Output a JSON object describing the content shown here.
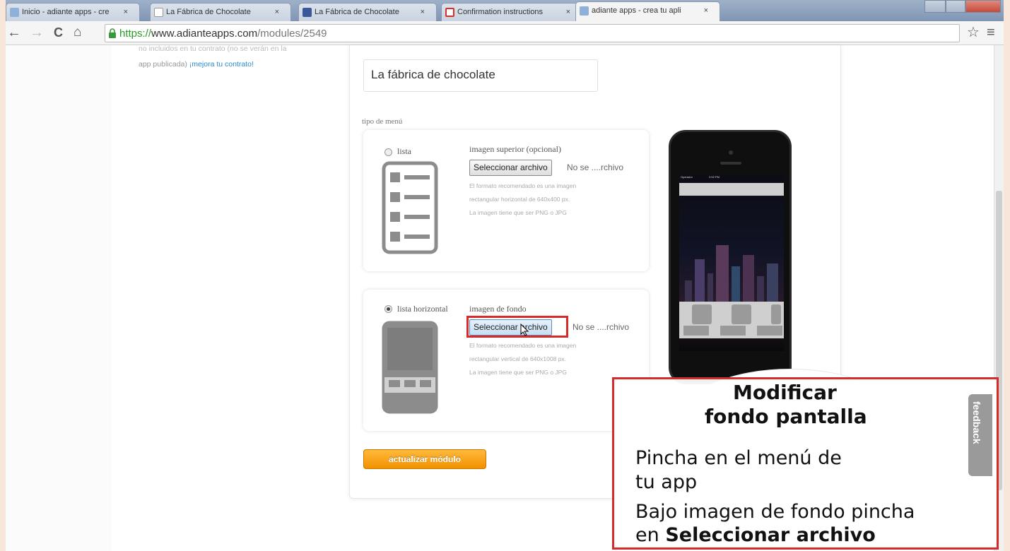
{
  "tabs": [
    {
      "label": "Inicio - adiante apps - cre",
      "favicon_color": "#8fb0d8"
    },
    {
      "label": "La Fábrica de Chocolate",
      "favicon_color": "#ffffff"
    },
    {
      "label": "La Fábrica de Chocolate",
      "favicon_color": "#3b5998"
    },
    {
      "label": "Confirmation instructions",
      "favicon_color": "#d93025"
    },
    {
      "label": "adiante apps - crea tu apli",
      "favicon_color": "#8fb0d8"
    }
  ],
  "tab_close": "×",
  "address": {
    "scheme": "https://",
    "host": "www.adianteapps.com",
    "path": "/modules/2549"
  },
  "nav": {
    "back": "←",
    "forward": "→",
    "reload": "C",
    "home": "⌂",
    "star": "☆",
    "menu": "≡"
  },
  "left_note": {
    "line1": "no incluidos en tu contrato (no se verán en la",
    "line2": "app publicada)",
    "link": "¡mejora tu contrato!"
  },
  "app_title": "La fábrica de chocolate",
  "menu_type_label": "tipo de menú",
  "option_list": {
    "label": "lista",
    "selected": false,
    "image_label": "imagen superior (opcional)",
    "button": "Seleccionar archivo",
    "no_file": "No se ....rchivo",
    "hint1": "El formato recomendado es una imagen",
    "hint2": "rectangular horizontal de 640x400 px.",
    "hint3": "La imagen tiene que ser PNG o JPG"
  },
  "option_horizontal": {
    "label": "lista horizontal",
    "selected": true,
    "image_label": "imagen de fondo",
    "button": "Seleccionar archivo",
    "no_file": "No se ....rchivo",
    "hint1": "El formato recomendado es una imagen",
    "hint2": "rectangular vertical de 640x1008 px.",
    "hint3": "La imagen tiene que ser PNG o JPG"
  },
  "update_button": "actualizar módulo",
  "phone_status": {
    "carrier": "Operador",
    "time": "2:52 PM"
  },
  "callout": {
    "title1": "Modificar",
    "title2": "fondo pantalla",
    "step1a": "Pincha en el menú de",
    "step1b": "tu app",
    "step2a": "Bajo imagen de fondo pincha",
    "step2b_prefix": "en ",
    "step2b_bold": "Seleccionar archivo"
  },
  "feedback": "feedback",
  "colors": {
    "accent_orange": "#f29100",
    "highlight_red": "#d62b2b",
    "link_blue": "#2b8ac9"
  }
}
